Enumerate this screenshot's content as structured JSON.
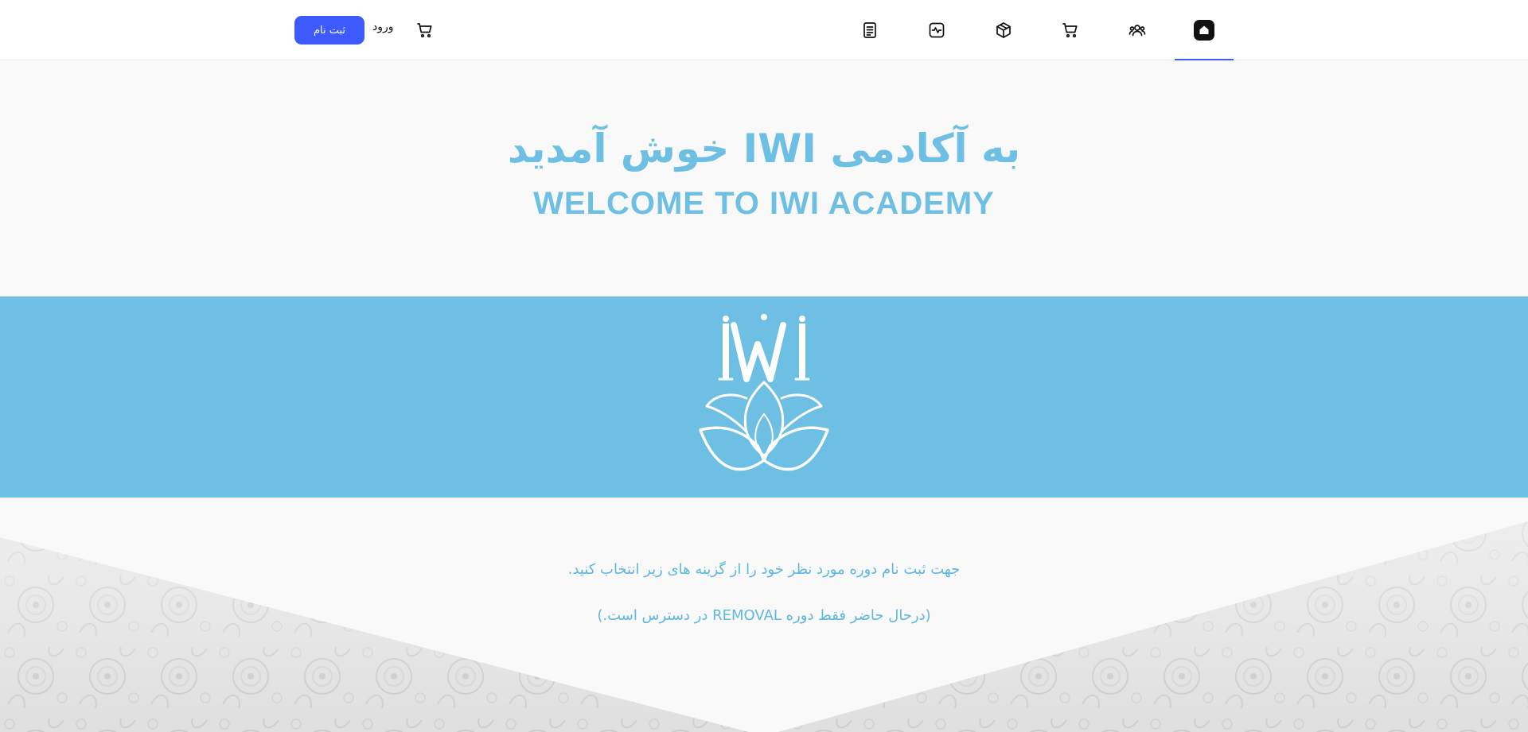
{
  "nav": {
    "items": [
      {
        "name": "home",
        "icon": "home-icon",
        "active": true
      },
      {
        "name": "users",
        "icon": "users-icon",
        "active": false
      },
      {
        "name": "cart",
        "icon": "shopping-cart-icon",
        "active": false
      },
      {
        "name": "package",
        "icon": "box-icon",
        "active": false
      },
      {
        "name": "activity",
        "icon": "activity-icon",
        "active": false
      },
      {
        "name": "document",
        "icon": "document-icon",
        "active": false
      }
    ],
    "accent_color": "#3d5afe"
  },
  "auth": {
    "login_label": "ورود",
    "register_label": "ثبت نام",
    "cart_icon": "shopping-cart-icon"
  },
  "hero": {
    "title_fa": "به آکادمی IWI خوش آمدید",
    "title_en": "WELCOME TO IWI ACADEMY",
    "color": "#6ebfe4"
  },
  "banner": {
    "color": "#6ebfe4",
    "logo": "iwi-lotus-logo",
    "logo_text": "IWI"
  },
  "info": {
    "line1": "جهت ثبت نام دوره مورد نظر خود را  از گزینه های زیر انتخاب کنید.",
    "line2": "(درحال حاضر فقط دوره REMOVAL در دسترس است.)"
  }
}
